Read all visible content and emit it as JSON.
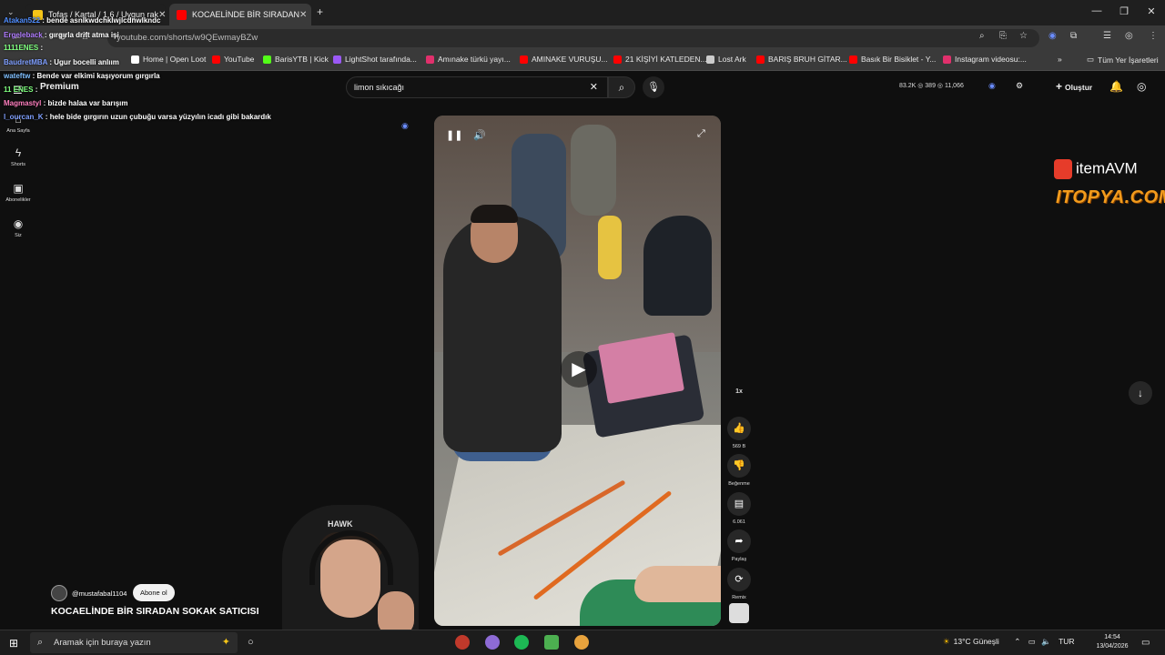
{
  "browser": {
    "tabs": [
      {
        "title": "Tofaş / Kartal / 1.6 / Uygun rak",
        "favicon_color": "#f5c518"
      },
      {
        "title": "KOCAELİNDE BİR SIRADAN",
        "favicon_color": "#ff0000"
      }
    ],
    "url": "youtube.com/shorts/w9QEwmayBZw",
    "bookmarks": [
      {
        "label": "Home | Open Loot",
        "color": "#ffffff"
      },
      {
        "label": "YouTube",
        "color": "#ff0000"
      },
      {
        "label": "BarisYTB | Kick",
        "color": "#53fc18"
      },
      {
        "label": "LightShot tarafında...",
        "color": "#9b59f6"
      },
      {
        "label": "Amınake türkü yayı...",
        "color": "#e1306c"
      },
      {
        "label": "AMINAKE VURUŞU...",
        "color": "#ff0000"
      },
      {
        "label": "21 KİŞİYİ KATLEDEN...",
        "color": "#ff0000"
      },
      {
        "label": "Lost Ark",
        "color": "#cccccc"
      },
      {
        "label": "BARIŞ BRUH GİTAR...",
        "color": "#ff0000"
      },
      {
        "label": "Basık Bir Bisiklet - Y...",
        "color": "#ff0000"
      },
      {
        "label": "Instagram videosu:...",
        "color": "#e1306c"
      }
    ],
    "all_bookmarks": "Tüm Yer İşaretleri"
  },
  "youtube": {
    "premium_label": "Premium",
    "search_value": "limon sıkıcağı",
    "stats": "83.2K  ◎ 389  ◎ 11,066",
    "create_label": "Oluştur",
    "sidebar": [
      {
        "label": "Ana Sayfa",
        "icon": "home-icon",
        "glyph": "⌂"
      },
      {
        "label": "Shorts",
        "icon": "shorts-icon",
        "glyph": "ϟ"
      },
      {
        "label": "Abonelikler",
        "icon": "subscriptions-icon",
        "glyph": "▣"
      },
      {
        "label": "Siz",
        "icon": "profile-icon",
        "glyph": "◉"
      }
    ],
    "actions": [
      {
        "label": "569 B",
        "icon": "like-icon",
        "glyph": "👍"
      },
      {
        "label": "Beğenme",
        "icon": "dislike-icon",
        "glyph": "👎"
      },
      {
        "label": "6.061",
        "icon": "comment-icon",
        "glyph": "▤"
      },
      {
        "label": "Paylaş",
        "icon": "share-icon",
        "glyph": "➦"
      },
      {
        "label": "Remix",
        "icon": "remix-icon",
        "glyph": "⟳"
      }
    ],
    "speed": "1x",
    "channel": "@mustafabal1104",
    "subscribe_label": "Abone ol",
    "video_title": "KOCAELİNDE BİR SIRADAN SOKAK SATICISI"
  },
  "chat": [
    {
      "user": "Atakan522",
      "text": "bende asnlkwdchklwjlcdnwlkndc",
      "color": "#4f8dff"
    },
    {
      "user": "Ergeleback",
      "text": "gırgırla drift atma işi",
      "color": "#b07cff"
    },
    {
      "user": "1111ENES",
      "text": "",
      "color": "#7fff7f"
    },
    {
      "user": "BaudretMBA",
      "text": "Ugur bocelli anlıım",
      "color": "#7f9fff"
    },
    {
      "user": "11 ENES",
      "text": "",
      "color": "#7fff7f"
    },
    {
      "user": "wateftw",
      "text": "Bende var elkimi kaşıyorum gırgırla",
      "color": "#7fbfff"
    },
    {
      "user": "Magmastyl",
      "text": "bizde halaa var barışım",
      "color": "#ff7fbf"
    },
    {
      "user": "l_ourcan_K",
      "text": "hele bide gırgırın uzun çubuğu varsa yüzyılın icadı gibi bakardık",
      "color": "#7f9fff"
    }
  ],
  "sponsors": {
    "itemavm": "itemAVM",
    "itopya": "ITOPYA.COM"
  },
  "cam": {
    "chair_brand": "HAWK"
  },
  "taskbar": {
    "search_placeholder": "Aramak için buraya yazın",
    "weather": "13°C  Güneşli",
    "lang": "TUR",
    "time": "14:54",
    "date": "13/04/2026"
  }
}
